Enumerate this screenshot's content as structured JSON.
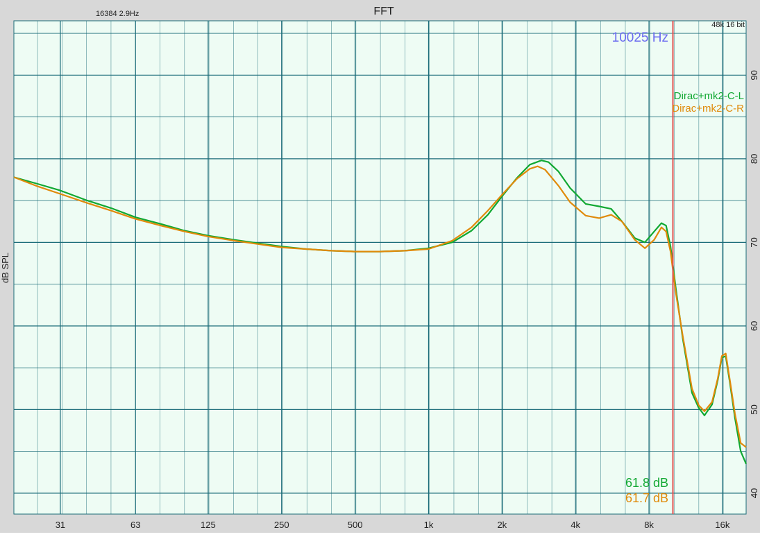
{
  "header": {
    "title": "FFT",
    "fft_info": "16384  2.9Hz",
    "format": "48k 16 bit"
  },
  "cursor": {
    "freq_label": "10025 Hz",
    "freq": 10025,
    "readouts": [
      "61.8 dB",
      "61.7 dB"
    ]
  },
  "colors": {
    "plot_bg": "#eefcf4",
    "grid": "#1a6b78",
    "cursor": "#e05050",
    "freq_label": "#6a6af0",
    "series_L": "#11a832",
    "series_R": "#e08a0a"
  },
  "chart_data": {
    "type": "line",
    "title": "FFT",
    "xlabel": "",
    "ylabel": "dB SPL",
    "x_scale": "log",
    "xlim": [
      20,
      20000
    ],
    "ylim": [
      37.5,
      96.5
    ],
    "grid": true,
    "legend_position": "top-right",
    "x_ticks": [
      31,
      63,
      125,
      250,
      500,
      1000,
      2000,
      4000,
      8000,
      16000
    ],
    "x_tick_labels": [
      "31",
      "63",
      "125",
      "250",
      "500",
      "1k",
      "2k",
      "4k",
      "8k",
      "16k"
    ],
    "y_ticks": [
      40,
      50,
      60,
      70,
      80,
      90
    ],
    "series": [
      {
        "name": "Dirac+mk2-C-L",
        "x": [
          20,
          25,
          31,
          40,
          50,
          63,
          80,
          100,
          125,
          160,
          200,
          250,
          315,
          400,
          500,
          630,
          800,
          1000,
          1250,
          1500,
          1750,
          2000,
          2300,
          2600,
          2900,
          3100,
          3400,
          3800,
          4400,
          5000,
          5600,
          6200,
          7000,
          7700,
          8400,
          9000,
          9400,
          9800,
          10300,
          11000,
          12000,
          12800,
          13500,
          14500,
          15300,
          15900,
          16500,
          17200,
          18000,
          19000,
          20000
        ],
        "y": [
          77.8,
          77.0,
          76.2,
          75.0,
          74.1,
          73.0,
          72.2,
          71.4,
          70.8,
          70.3,
          69.9,
          69.5,
          69.2,
          69.0,
          68.9,
          68.9,
          69.0,
          69.3,
          70.0,
          71.4,
          73.3,
          75.5,
          77.7,
          79.3,
          79.8,
          79.6,
          78.5,
          76.5,
          74.6,
          74.3,
          74.0,
          72.5,
          70.5,
          70.0,
          71.3,
          72.3,
          72.0,
          69.5,
          64.5,
          58.5,
          52.0,
          50.2,
          49.3,
          50.6,
          53.5,
          56.2,
          56.4,
          53.0,
          49.0,
          45.0,
          43.5
        ]
      },
      {
        "name": "Dirac+mk2-C-R",
        "x": [
          20,
          25,
          31,
          40,
          50,
          63,
          80,
          100,
          125,
          160,
          200,
          250,
          315,
          400,
          500,
          630,
          800,
          1000,
          1250,
          1500,
          1750,
          2000,
          2300,
          2600,
          2800,
          3000,
          3400,
          3800,
          4400,
          5000,
          5600,
          6200,
          7000,
          7700,
          8400,
          9000,
          9400,
          9800,
          10300,
          11000,
          12000,
          12800,
          13500,
          14500,
          15300,
          15900,
          16500,
          17200,
          18000,
          19000,
          20000
        ],
        "y": [
          77.8,
          76.7,
          75.8,
          74.7,
          73.8,
          72.8,
          72.0,
          71.3,
          70.7,
          70.2,
          69.8,
          69.4,
          69.2,
          69.0,
          68.9,
          68.9,
          69.0,
          69.2,
          70.2,
          71.8,
          73.8,
          75.7,
          77.6,
          78.8,
          79.1,
          78.7,
          76.8,
          74.8,
          73.2,
          72.9,
          73.3,
          72.5,
          70.3,
          69.3,
          70.3,
          71.8,
          71.3,
          68.9,
          64.0,
          58.8,
          52.5,
          50.5,
          49.8,
          50.9,
          53.7,
          56.4,
          56.7,
          53.3,
          49.5,
          46.0,
          45.5
        ]
      }
    ]
  }
}
